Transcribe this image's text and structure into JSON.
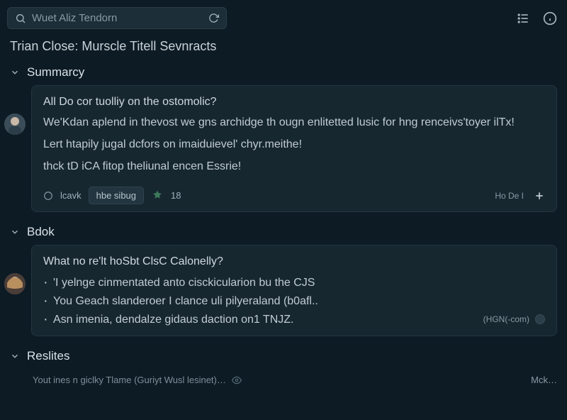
{
  "search": {
    "placeholder": "Wuet Aliz Tendorn"
  },
  "breadcrumb": "Trian Close: Murscle Titell Sevnracts",
  "sections": {
    "summary": {
      "title": "Summarcy",
      "question": "All Do cor tuolliy on the ostomolic?",
      "lines": [
        "We'Kdan aplend in thevost we gns archidge th ougn enlitetted lusic for hng renceivs'toyer ilTx!",
        "Lert htapily jugal dcfors on imaiduievel' chyr.meithe!",
        "thck tD iCA fitop theliunal encen Essrie!"
      ],
      "pill_left": "lcavk",
      "pill_right": "hbe sibug",
      "reaction_count": "18",
      "footer_hint": "Ho De I"
    },
    "bdok": {
      "title": "Bdok",
      "question": "What no re'lt hoSbt ClsC Calonelly?",
      "bullets": [
        "'I yelnge cinmentated anto cisckicularion bu the CJS",
        "You Geach slanderoer I clance uli pilyeraland (b0afl..",
        "Asn imenia, dendalze gidaus daction on1 TNJZ."
      ],
      "bullet_meta": "(HGN(-com)"
    },
    "reslites": {
      "title": "Reslites",
      "truncated": "Yout ines n giclky Tlame (Guriyt Wusl lesinet)…",
      "truncated_right": "Mck…"
    }
  }
}
